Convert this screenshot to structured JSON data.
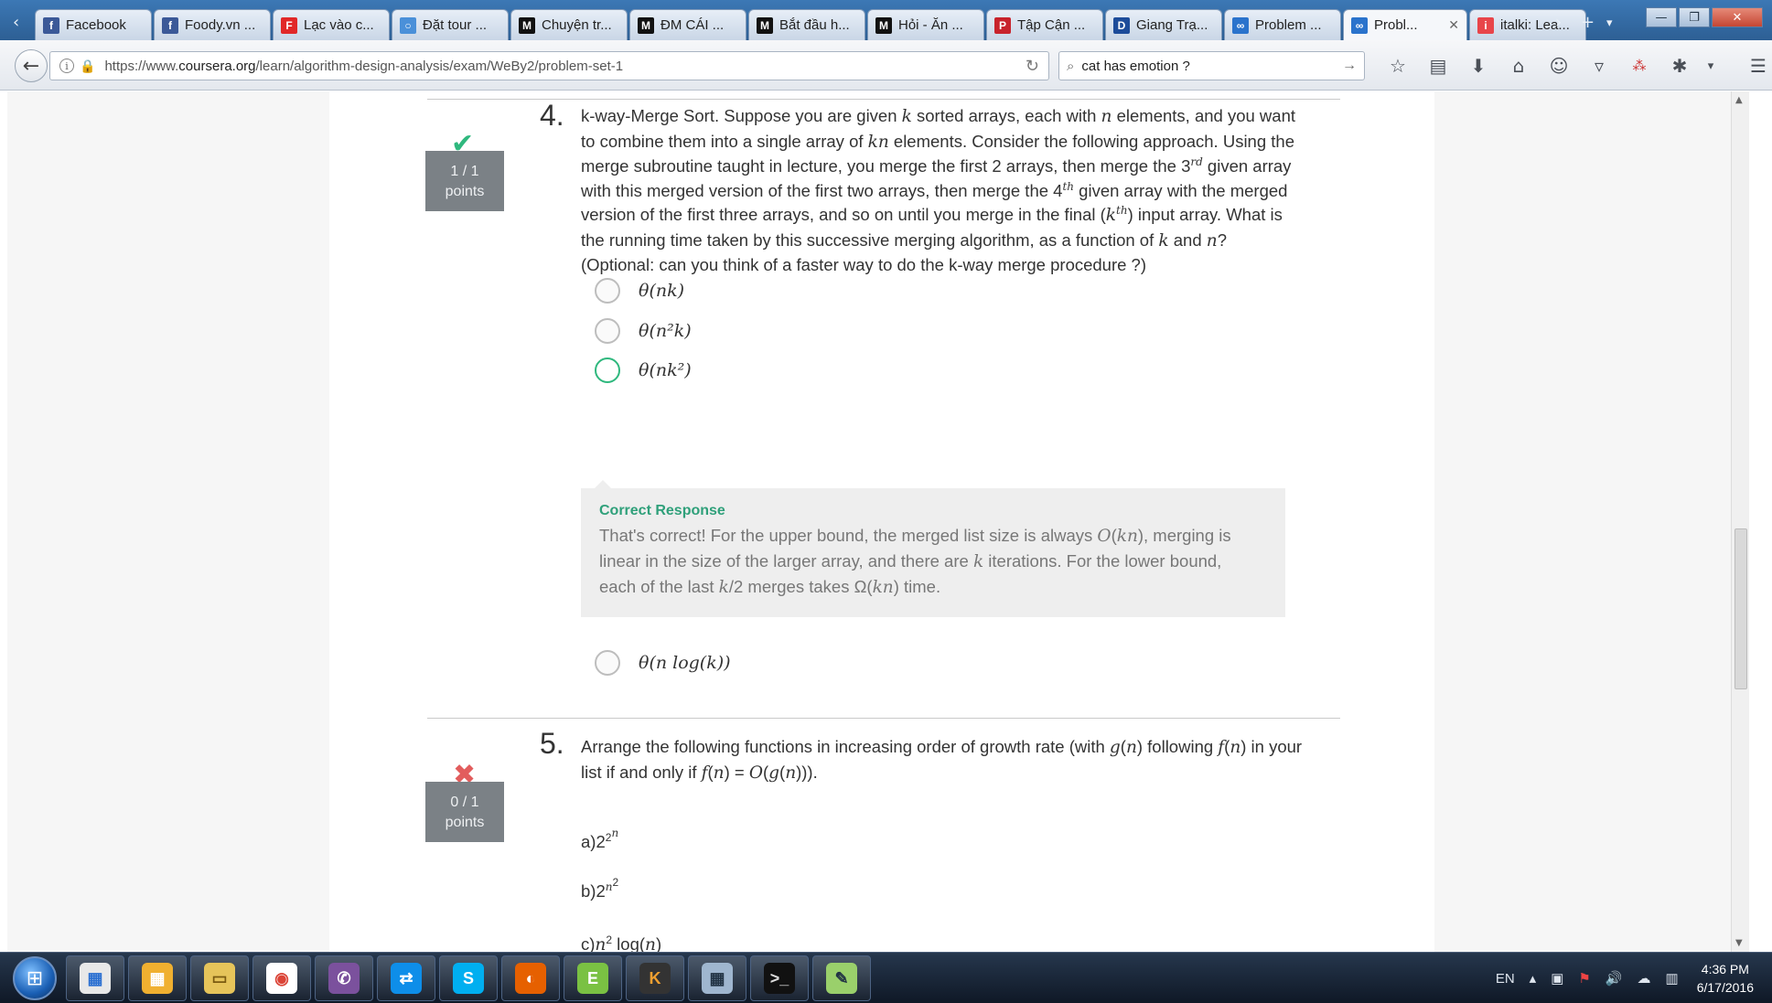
{
  "browser": {
    "tabs": [
      {
        "label": "Facebook",
        "icon": "facebook-icon",
        "color": "#3b5998",
        "glyph": "f"
      },
      {
        "label": "Foody.vn ...",
        "icon": "facebook-icon",
        "color": "#3b5998",
        "glyph": "f"
      },
      {
        "label": "Lạc vào c...",
        "icon": "flipboard-icon",
        "color": "#e12828",
        "glyph": "F"
      },
      {
        "label": "Đặt tour ...",
        "icon": "globe-icon",
        "color": "#4a90d9",
        "glyph": "○"
      },
      {
        "label": "Chuyện tr...",
        "icon": "medium-icon",
        "color": "#111111",
        "glyph": "M"
      },
      {
        "label": "ĐM CÁI ...",
        "icon": "medium-icon",
        "color": "#111111",
        "glyph": "M"
      },
      {
        "label": "Bắt đầu h...",
        "icon": "medium-icon",
        "color": "#111111",
        "glyph": "M"
      },
      {
        "label": "Hỏi - Ăn ...",
        "icon": "medium-icon",
        "color": "#111111",
        "glyph": "M"
      },
      {
        "label": "Tập Cận ...",
        "icon": "pinterest-icon",
        "color": "#c8232c",
        "glyph": "P"
      },
      {
        "label": "Giang Trạ...",
        "icon": "dkn-icon",
        "color": "#1d4c9a",
        "glyph": "D"
      },
      {
        "label": "Problem ...",
        "icon": "coursera-icon",
        "color": "#2a73cc",
        "glyph": "∞"
      },
      {
        "label": "Probl...",
        "icon": "coursera-icon",
        "color": "#2a73cc",
        "glyph": "∞",
        "active": true
      },
      {
        "label": "italki: Lea...",
        "icon": "italki-icon",
        "color": "#e8454a",
        "glyph": "i"
      }
    ],
    "url": {
      "scheme": "https://www.",
      "host": "coursera.org",
      "path": "/learn/algorithm-design-analysis/exam/WeBy2/problem-set-1"
    },
    "search_value": "cat has emotion ?"
  },
  "q4": {
    "number": "4.",
    "status": "correct",
    "points": "1 / 1",
    "points_label": "points",
    "options": [
      {
        "text": "θ(nk)",
        "state": "unselected"
      },
      {
        "text": "θ(n²k)",
        "state": "unselected"
      },
      {
        "text": "θ(nk²)",
        "state": "selected-correct"
      },
      {
        "text": "θ(n log(k))",
        "state": "unselected"
      }
    ],
    "feedback": {
      "title": "Correct Response"
    }
  },
  "q5": {
    "number": "5.",
    "status": "incorrect",
    "points": "0 / 1",
    "points_label": "points"
  },
  "taskbar": {
    "apps": [
      "windows-explorer",
      "metro-apps",
      "file-explorer",
      "chrome",
      "viber",
      "teamviewer",
      "skype",
      "firefox",
      "evernote",
      "kindle",
      "calculator",
      "cmd",
      "notepad"
    ],
    "lang": "EN",
    "time": "4:36 PM",
    "date": "6/17/2016"
  },
  "colors": {
    "correct": "#2fb87e",
    "incorrect": "#e25d5d",
    "points_box": "#7b8186",
    "feedback_title": "#2fa07a"
  }
}
